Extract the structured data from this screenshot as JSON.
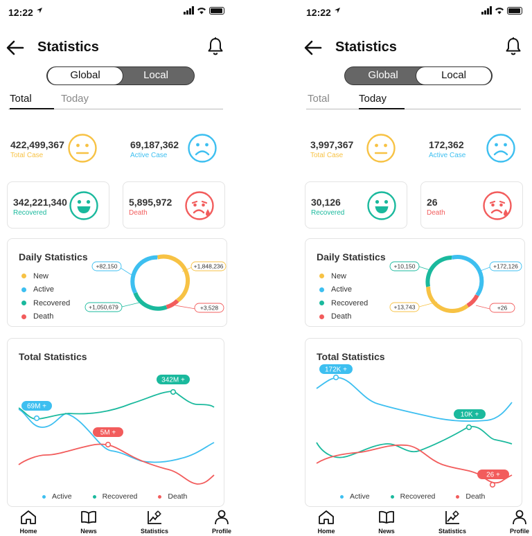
{
  "colors": {
    "new": "#f7c244",
    "active": "#3dbff0",
    "recovered": "#1ab99d",
    "death": "#f25c5c"
  },
  "screens": [
    {
      "status": {
        "time": "12:22"
      },
      "header": {
        "title": "Statistics"
      },
      "segment": {
        "left": "Global",
        "right": "Local",
        "selected": "right"
      },
      "tabs": [
        {
          "label": "Total",
          "active": true
        },
        {
          "label": "Today",
          "active": false
        }
      ],
      "stats": {
        "total": {
          "value": "422,499,367",
          "label": "Total Case",
          "face": "neutral"
        },
        "active": {
          "value": "69,187,362",
          "label": "Active Case",
          "face": "sad"
        },
        "recovered": {
          "value": "342,221,340",
          "label": "Recovered",
          "face": "happy"
        },
        "death": {
          "value": "5,895,972",
          "label": "Death",
          "face": "crying"
        }
      },
      "daily": {
        "title": "Daily Statistics",
        "legend": [
          "New",
          "Active",
          "Recovered",
          "Death"
        ],
        "callouts": {
          "top_left": "+82,150",
          "top_right": "+1,848,236",
          "bottom_left": "+1,050,679",
          "bottom_right": "+3,528"
        },
        "ring_fractions": {
          "new": 0.44,
          "active": 0.19,
          "recovered": 0.3,
          "death": 0.07
        }
      },
      "total_chart": {
        "title": "Total Statistics",
        "legend": [
          "Active",
          "Recovered",
          "Death"
        ],
        "labels": {
          "active": "69M +",
          "recovered": "342M +",
          "death": "5M +"
        }
      },
      "nav": [
        "Home",
        "News",
        "Statistics",
        "Profile"
      ]
    },
    {
      "status": {
        "time": "12:22"
      },
      "header": {
        "title": "Statistics"
      },
      "segment": {
        "left": "Global",
        "right": "Local",
        "selected": "right"
      },
      "tabs": [
        {
          "label": "Total",
          "active": false
        },
        {
          "label": "Today",
          "active": true
        }
      ],
      "stats": {
        "total": {
          "value": "3,997,367",
          "label": "Total Case",
          "face": "neutral"
        },
        "active": {
          "value": "172,362",
          "label": "Active Case",
          "face": "sad"
        },
        "recovered": {
          "value": "30,126",
          "label": "Recovered",
          "face": "happy"
        },
        "death": {
          "value": "26",
          "label": "Death",
          "face": "crying"
        }
      },
      "daily": {
        "title": "Daily Statistics",
        "legend": [
          "New",
          "Active",
          "Recovered",
          "Death"
        ],
        "callouts": {
          "top_left": "+10,150",
          "top_right": "+172,126",
          "bottom_left": "+13,743",
          "bottom_right": "+26"
        },
        "ring_fractions": {
          "active": 0.47,
          "recovered": 0.22,
          "new": 0.24,
          "death": 0.07
        }
      },
      "total_chart": {
        "title": "Total Statistics",
        "legend": [
          "Active",
          "Recovered",
          "Death"
        ],
        "labels": {
          "active": "172K +",
          "recovered": "10K +",
          "death": "26 +"
        }
      },
      "nav": [
        "Home",
        "News",
        "Statistics",
        "Profile"
      ]
    }
  ]
}
